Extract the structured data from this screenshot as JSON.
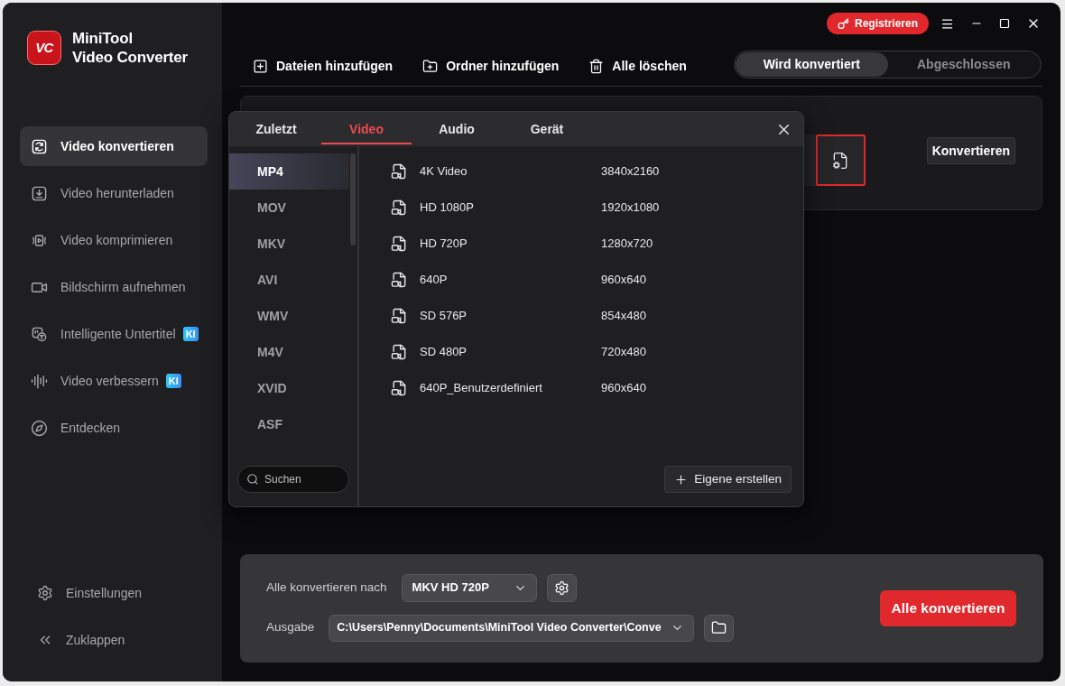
{
  "app": {
    "logo_text": "VC",
    "name_lines": [
      "MiniTool",
      "Video Converter"
    ]
  },
  "sidebar": {
    "items": [
      {
        "label": "Video konvertieren",
        "selected": true
      },
      {
        "label": "Video herunterladen",
        "selected": false
      },
      {
        "label": "Video komprimieren",
        "selected": false
      },
      {
        "label": "Bildschirm aufnehmen",
        "selected": false
      },
      {
        "label": "Intelligente Untertitel",
        "selected": false,
        "badge": "KI"
      },
      {
        "label": "Video verbessern",
        "selected": false,
        "badge": "KI"
      },
      {
        "label": "Entdecken",
        "selected": false
      }
    ],
    "footer_items": [
      "Einstellungen",
      "Zuklappen"
    ]
  },
  "title_bar": {
    "register_button": "Registrieren"
  },
  "toolbar": {
    "actions": [
      "Dateien hinzufügen",
      "Ordner hinzufügen",
      "Alle löschen"
    ],
    "tabs": [
      {
        "label": "Wird konvertiert",
        "selected": true
      },
      {
        "label": "Abgeschlossen",
        "selected": false
      }
    ]
  },
  "file_card": {
    "convert_button": "Konvertieren"
  },
  "format_dialog": {
    "tabs": [
      {
        "label": "Zuletzt",
        "selected": false
      },
      {
        "label": "Video",
        "selected": true
      },
      {
        "label": "Audio",
        "selected": false
      },
      {
        "label": "Gerät",
        "selected": false
      }
    ],
    "formats": [
      {
        "label": "MP4",
        "selected": true
      },
      {
        "label": "MOV",
        "selected": false
      },
      {
        "label": "MKV",
        "selected": false
      },
      {
        "label": "AVI",
        "selected": false
      },
      {
        "label": "WMV",
        "selected": false
      },
      {
        "label": "M4V",
        "selected": false
      },
      {
        "label": "XVID",
        "selected": false
      },
      {
        "label": "ASF",
        "selected": false
      }
    ],
    "search": {
      "placeholder": "Suchen"
    },
    "presets": [
      {
        "name": "4K Video",
        "resolution": "3840x2160"
      },
      {
        "name": "HD 1080P",
        "resolution": "1920x1080"
      },
      {
        "name": "HD 720P",
        "resolution": "1280x720"
      },
      {
        "name": "640P",
        "resolution": "960x640"
      },
      {
        "name": "SD 576P",
        "resolution": "854x480"
      },
      {
        "name": "SD 480P",
        "resolution": "720x480"
      },
      {
        "name": "640P_Benutzerdefiniert",
        "resolution": "960x640"
      }
    ],
    "create_button": "Eigene erstellen"
  },
  "bottom_bar": {
    "convert_to_label": "Alle konvertieren nach",
    "convert_to_value": "MKV HD 720P",
    "output_label": "Ausgabe",
    "output_value": "C:\\Users\\Penny\\Documents\\MiniTool Video Converter\\Conve",
    "convert_all_button": "Alle konvertieren"
  }
}
